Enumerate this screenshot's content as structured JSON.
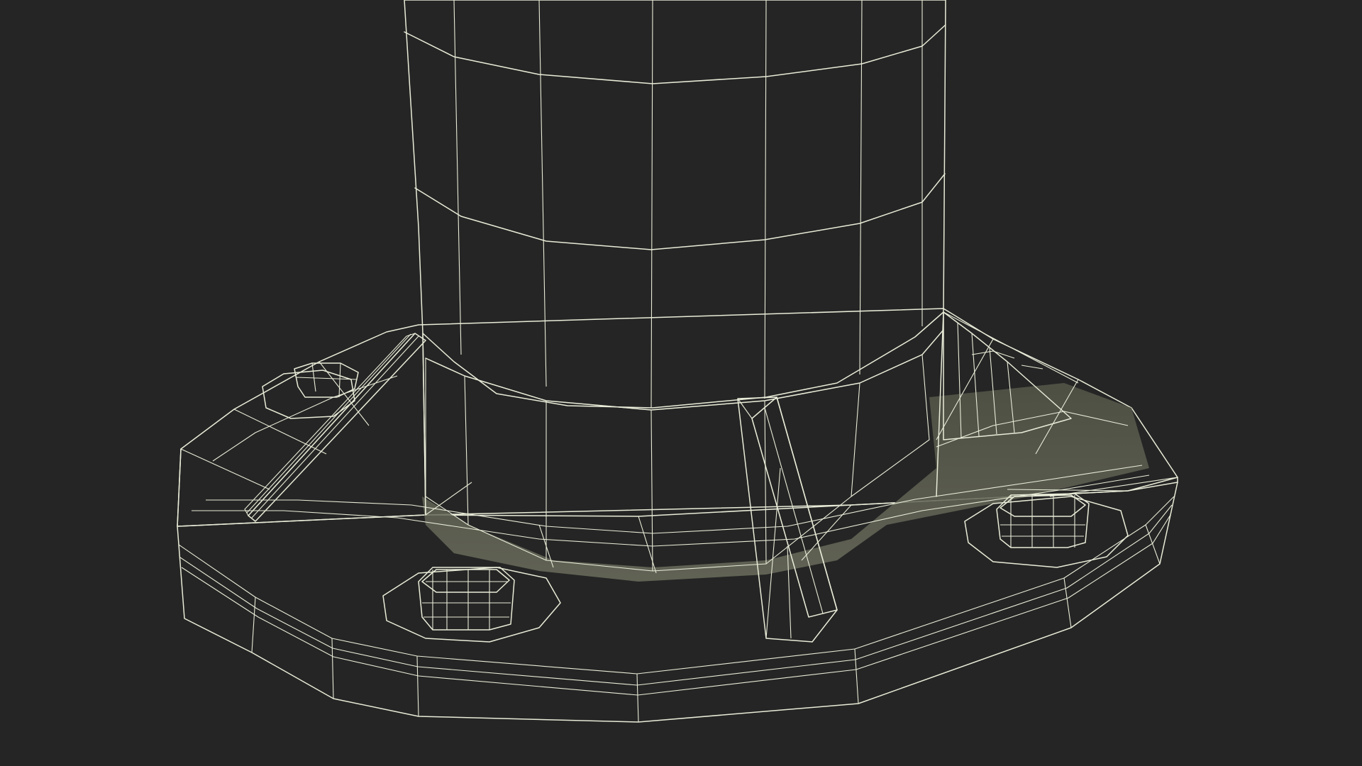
{
  "scene": {
    "subject": "",
    "background_color": "#252525",
    "mesh_color": "#7b7d6b",
    "mesh_shadow_color": "#5f6153",
    "mesh_highlight_color": "#888a77",
    "wireframe_color": "#e9ecd8",
    "bolt_count": 4,
    "gusset_count": 3
  }
}
